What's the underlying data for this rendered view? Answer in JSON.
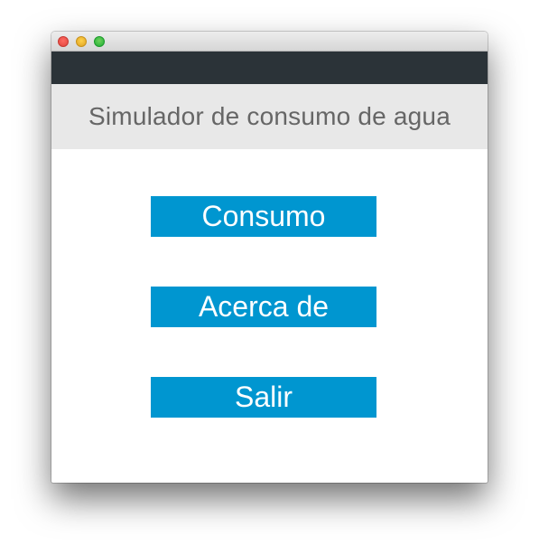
{
  "window": {
    "title_controls": [
      "close",
      "minimize",
      "maximize"
    ]
  },
  "header": {
    "title": "Simulador de consumo de agua"
  },
  "menu": {
    "buttons": [
      {
        "label": "Consumo"
      },
      {
        "label": "Acerca de"
      },
      {
        "label": "Salir"
      }
    ]
  },
  "colors": {
    "accent": "#0096d0",
    "toolbar": "#2b3338",
    "header_bg": "#e8e8e8",
    "header_text": "#666666"
  }
}
